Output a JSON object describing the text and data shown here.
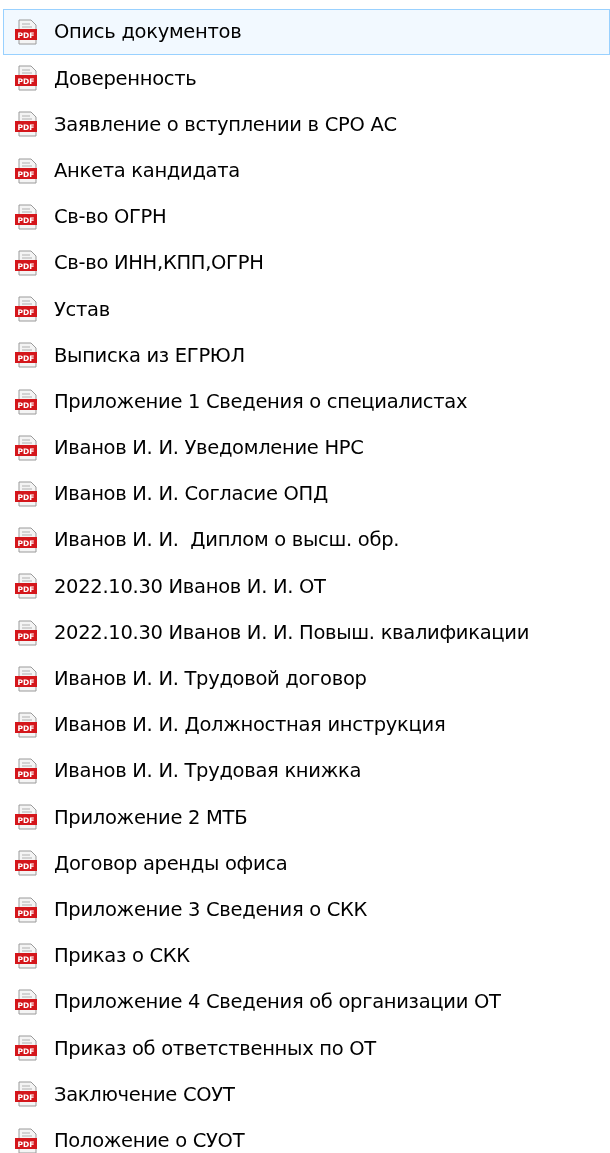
{
  "files": [
    {
      "name": "Опись документов",
      "icon_label": "PDF",
      "selected": true
    },
    {
      "name": "Доверенность",
      "icon_label": "PDF",
      "selected": false
    },
    {
      "name": "Заявление о вступлении в СРО АС",
      "icon_label": "PDF",
      "selected": false
    },
    {
      "name": "Анкета кандидата",
      "icon_label": "PDF",
      "selected": false
    },
    {
      "name": "Св-во ОГРН",
      "icon_label": "PDF",
      "selected": false
    },
    {
      "name": "Св-во ИНН,КПП,ОГРН",
      "icon_label": "PDF",
      "selected": false
    },
    {
      "name": "Устав",
      "icon_label": "PDF",
      "selected": false
    },
    {
      "name": "Выписка из ЕГРЮЛ",
      "icon_label": "PDF",
      "selected": false
    },
    {
      "name": "Приложение 1 Сведения о специалистах",
      "icon_label": "PDF",
      "selected": false
    },
    {
      "name": "Иванов И. И. Уведомление НРС",
      "icon_label": "PDF",
      "selected": false
    },
    {
      "name": "Иванов И. И. Согласие ОПД",
      "icon_label": "PDF",
      "selected": false
    },
    {
      "name": "Иванов И. И.  Диплом о высш. обр.",
      "icon_label": "PDF",
      "selected": false
    },
    {
      "name": "2022.10.30 Иванов И. И. ОТ",
      "icon_label": "PDF",
      "selected": false
    },
    {
      "name": "2022.10.30 Иванов И. И. Повыш. квалификации",
      "icon_label": "PDF",
      "selected": false
    },
    {
      "name": "Иванов И. И. Трудовой договор",
      "icon_label": "PDF",
      "selected": false
    },
    {
      "name": "Иванов И. И. Должностная инструкция",
      "icon_label": "PDF",
      "selected": false
    },
    {
      "name": "Иванов И. И. Трудовая книжка",
      "icon_label": "PDF",
      "selected": false
    },
    {
      "name": "Приложение 2 МТБ",
      "icon_label": "PDF",
      "selected": false
    },
    {
      "name": "Договор аренды офиса",
      "icon_label": "PDF",
      "selected": false
    },
    {
      "name": "Приложение 3 Сведения о СКК",
      "icon_label": "PDF",
      "selected": false
    },
    {
      "name": "Приказ о СКК",
      "icon_label": "PDF",
      "selected": false
    },
    {
      "name": "Приложение 4 Сведения об организации ОТ",
      "icon_label": "PDF",
      "selected": false
    },
    {
      "name": "Приказ об ответственных по ОТ",
      "icon_label": "PDF",
      "selected": false
    },
    {
      "name": "Заключение СОУТ",
      "icon_label": "PDF",
      "selected": false
    },
    {
      "name": "Положение о СУОТ",
      "icon_label": "PDF",
      "selected": false
    }
  ]
}
